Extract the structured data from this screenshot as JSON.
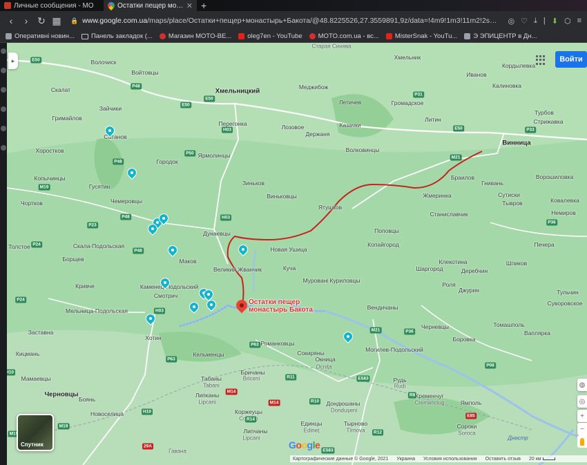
{
  "colors": {
    "tab_bg": "#111214",
    "toolbar_bg": "#2b2c30",
    "map_land": "#a5d8a9",
    "route": "#c5221f",
    "poi": "#12b5cb",
    "pin": "#ea4335",
    "signin": "#1a73e8"
  },
  "tabs": [
    {
      "title": "Личные сообщения - MO",
      "icon": "vk-icon"
    },
    {
      "title": "Остатки пещер монастыр",
      "icon": "google-maps-icon"
    }
  ],
  "address": {
    "host": "www.google.com.ua",
    "path": "/maps/place/Остатки+пещер+монастырь+Бакота/@48.8225526,27.3559891,9z/data=!4m9!1m3!11m2!2sYQzoin7Be"
  },
  "bookmarks": [
    {
      "label": "Оперативні новин...",
      "icon": "site-icon"
    },
    {
      "label": "Панель закладок (...",
      "icon": "folder-icon"
    },
    {
      "label": "Магазин MOTO-BE...",
      "icon": "moto-icon"
    },
    {
      "label": "oleg7en - YouTube",
      "icon": "youtube-icon"
    },
    {
      "label": "MOTO.com.ua - вс...",
      "icon": "moto-icon"
    },
    {
      "label": "MisterSnak - YouTu...",
      "icon": "youtube-icon"
    },
    {
      "label": "Э ЭПИЦЕНТР в Дн...",
      "icon": "site-icon"
    }
  ],
  "map": {
    "signin_label": "Войти",
    "satellite_label": "Спутник",
    "google_logo": [
      "G",
      "o",
      "o",
      "g",
      "l",
      "e"
    ],
    "pin_label_lines": [
      "Остатки пещер",
      "монастырь Бакота"
    ],
    "attribution": [
      "Картографические данные © Google, 2021",
      "Украина",
      "Условия использования",
      "Оставить отзыв",
      "20 км"
    ],
    "labels": [
      {
        "text": "Хмельницкий",
        "type": "city"
      },
      {
        "text": "Винница",
        "type": "city"
      },
      {
        "text": "Каменец-Подольский",
        "type": "town"
      },
      {
        "text": "Черновцы",
        "type": "city"
      },
      {
        "text": "Хотин",
        "type": "town"
      },
      {
        "text": "Могилев-Подольский",
        "type": "town"
      },
      {
        "text": "Жмеринка",
        "type": "town"
      },
      {
        "text": "Дунаевцы",
        "type": "town"
      },
      {
        "text": "Новая Ушица",
        "type": "town"
      },
      {
        "text": "Волочиск",
        "type": "town"
      },
      {
        "text": "Войтовцы",
        "type": "town"
      },
      {
        "text": "Старая Синява",
        "type": "faded"
      },
      {
        "text": "Хмельник",
        "type": "town"
      },
      {
        "text": "Иванов",
        "type": "town"
      },
      {
        "text": "Кордылевка",
        "type": "town"
      },
      {
        "text": "Калиновка",
        "type": "town"
      },
      {
        "text": "Меджибож",
        "type": "town"
      },
      {
        "text": "Летичев",
        "type": "town"
      },
      {
        "text": "Громадское",
        "type": "town"
      },
      {
        "text": "Литин",
        "type": "town"
      },
      {
        "text": "Турбов",
        "type": "town"
      },
      {
        "text": "Стрижавка",
        "type": "town"
      },
      {
        "text": "Скалат",
        "type": "town"
      },
      {
        "text": "Зайчики",
        "type": "town"
      },
      {
        "text": "Гримайлов",
        "type": "town"
      },
      {
        "text": "Сатанов",
        "type": "town"
      },
      {
        "text": "Перегонка",
        "type": "town"
      },
      {
        "text": "Лозовое",
        "type": "town"
      },
      {
        "text": "Казачки",
        "type": "town"
      },
      {
        "text": "Держаня",
        "type": "town"
      },
      {
        "text": "Волковинцы",
        "type": "town"
      },
      {
        "text": "Хоростков",
        "type": "town"
      },
      {
        "text": "Городок",
        "type": "town"
      },
      {
        "text": "Ярмолинцы",
        "type": "town"
      },
      {
        "text": "Копычинцы",
        "type": "town"
      },
      {
        "text": "Гусятин",
        "type": "town"
      },
      {
        "text": "Зиньков",
        "type": "town"
      },
      {
        "text": "Браилов",
        "type": "town"
      },
      {
        "text": "Гнивань",
        "type": "town"
      },
      {
        "text": "Ворошиловка",
        "type": "town"
      },
      {
        "text": "Сутиски",
        "type": "town"
      },
      {
        "text": "Тывров",
        "type": "town"
      },
      {
        "text": "Ковалевка",
        "type": "town"
      },
      {
        "text": "Немиров",
        "type": "town"
      },
      {
        "text": "Чортков",
        "type": "town"
      },
      {
        "text": "Чемеровцы",
        "type": "town"
      },
      {
        "text": "Виньковцы",
        "type": "town"
      },
      {
        "text": "Ятушков",
        "type": "town"
      },
      {
        "text": "Станиславчик",
        "type": "town"
      },
      {
        "text": "Толстое",
        "type": "town"
      },
      {
        "text": "Скала-Подольская",
        "type": "town"
      },
      {
        "text": "Копайгород",
        "type": "town"
      },
      {
        "text": "Поповцы",
        "type": "town"
      },
      {
        "text": "Печера",
        "type": "town"
      },
      {
        "text": "Борщев",
        "type": "town"
      },
      {
        "text": "Маков",
        "type": "town"
      },
      {
        "text": "Великий Жванчик",
        "type": "town"
      },
      {
        "text": "Куча",
        "type": "town"
      },
      {
        "text": "Клекотина",
        "type": "town"
      },
      {
        "text": "Шпиков",
        "type": "town"
      },
      {
        "text": "Шаргород",
        "type": "town"
      },
      {
        "text": "Деребчин",
        "type": "town"
      },
      {
        "text": "Кривче",
        "type": "town"
      },
      {
        "text": "Смотрич",
        "type": "town"
      },
      {
        "text": "Муровані Куриловцы",
        "type": "town"
      },
      {
        "text": "Роля",
        "type": "town"
      },
      {
        "text": "Джурин",
        "type": "town"
      },
      {
        "text": "Тульчин",
        "type": "town"
      },
      {
        "text": "Мельница-Подольская",
        "type": "town"
      },
      {
        "text": "Вендичаны",
        "type": "town"
      },
      {
        "text": "Суворовское",
        "type": "town"
      },
      {
        "text": "Черневцы",
        "type": "town"
      },
      {
        "text": "Томашполь",
        "type": "town"
      },
      {
        "text": "Ваплярка",
        "type": "town"
      },
      {
        "text": "Заставна",
        "type": "town"
      },
      {
        "text": "Романковцы",
        "type": "town"
      },
      {
        "text": "Боровка",
        "type": "town"
      },
      {
        "text": "Кицмань",
        "type": "town"
      },
      {
        "text": "Кельменцы",
        "type": "town"
      },
      {
        "text": "Сокиряны",
        "type": "town"
      },
      {
        "text": "Окница",
        "type": "town"
      },
      {
        "text": "Ocnița",
        "type": "faded"
      },
      {
        "text": "Мамаевцы",
        "type": "town"
      },
      {
        "text": "Бричаны",
        "type": "town"
      },
      {
        "text": "Briceni",
        "type": "faded"
      },
      {
        "text": "Табаны",
        "type": "town"
      },
      {
        "text": "Tabani",
        "type": "faded"
      },
      {
        "text": "Рудь",
        "type": "town"
      },
      {
        "text": "Rudi",
        "type": "faded"
      },
      {
        "text": "Кременчуг",
        "type": "town"
      },
      {
        "text": "Cremenciug",
        "type": "faded"
      },
      {
        "text": "Ямполь",
        "type": "town"
      },
      {
        "text": "Боянь",
        "type": "town"
      },
      {
        "text": "Липканы",
        "type": "town"
      },
      {
        "text": "Lipcani",
        "type": "faded"
      },
      {
        "text": "Дондюшаны",
        "type": "town"
      },
      {
        "text": "Dondușeni",
        "type": "faded"
      },
      {
        "text": "Новоселица",
        "type": "town"
      },
      {
        "text": "Коржеуцы",
        "type": "town"
      },
      {
        "text": "Corjeuți",
        "type": "faded"
      },
      {
        "text": "Единцы",
        "type": "town"
      },
      {
        "text": "Edineț",
        "type": "faded"
      },
      {
        "text": "Тырново",
        "type": "town"
      },
      {
        "text": "Tîrnova",
        "type": "faded"
      },
      {
        "text": "Сороки",
        "type": "town"
      },
      {
        "text": "Soroca",
        "type": "faded"
      },
      {
        "text": "Липчаны",
        "type": "town"
      },
      {
        "text": "Lipcani",
        "type": "faded"
      },
      {
        "text": "Днестр",
        "type": "river"
      },
      {
        "text": "Гавана",
        "type": "faded"
      }
    ],
    "shields": [
      "E50",
      "E50",
      "E50",
      "E50",
      "P48",
      "P48",
      "P48",
      "P48",
      "H03",
      "H03",
      "H03",
      "M19",
      "M19",
      "M19",
      "M21",
      "M21",
      "P31",
      "P33",
      "P36",
      "P36",
      "P24",
      "P24",
      "P23",
      "P50",
      "P63",
      "P63",
      "P08",
      "M14",
      "R10",
      "R11",
      "R14",
      "R12",
      "E583",
      "E583",
      "H10",
      "H10",
      "M14",
      "E85",
      "29A",
      "R8"
    ]
  }
}
